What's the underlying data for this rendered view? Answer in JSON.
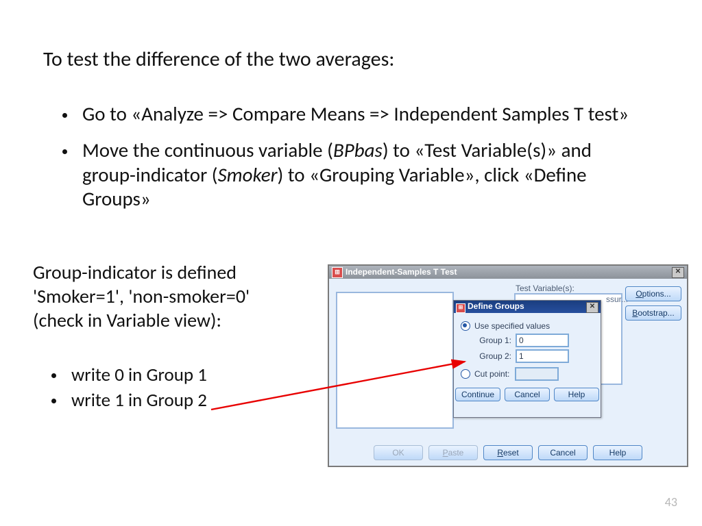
{
  "heading": "To test the difference of the two averages:",
  "bullets_main": [
    {
      "pre": "Go to «Analyze => Compare Means => Independent Samples T test»"
    },
    {
      "pre": "Move the continuous variable (",
      "it1": "BPbas",
      "mid": ") to «Test Variable(s)» and group-indicator (",
      "it2": "Smoker",
      "post": ") to «Grouping Variable», click «Define Groups»"
    }
  ],
  "para2_l1": "Group-indicator is defined",
  "para2_l2": "'Smoker=1', 'non-smoker=0'",
  "para2_l3": "(check in Variable view):",
  "bullets_sub": [
    "write 0 in Group 1",
    "write 1 in Group 2"
  ],
  "pagenum": "43",
  "dialog": {
    "title": "Independent-Samples T Test",
    "tv_label": "Test Variable(s):",
    "rightbox_cut": "ssur...",
    "side_buttons": {
      "options": "Options...",
      "bootstrap": "Bootstrap..."
    },
    "bottom": {
      "ok": "OK",
      "paste": "Paste",
      "reset": "Reset",
      "cancel": "Cancel",
      "help": "Help"
    },
    "sub": {
      "title": "Define Groups",
      "use_spec": "Use specified values",
      "g1_label": "Group 1:",
      "g2_label": "Group 2:",
      "g1_value": "0",
      "g2_value": "1",
      "cut_label": "Cut point:",
      "continue": "Continue",
      "cancel": "Cancel",
      "help": "Help"
    }
  }
}
